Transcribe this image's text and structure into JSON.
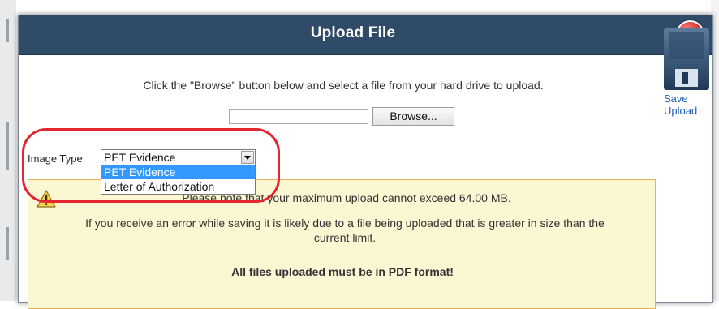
{
  "dialog": {
    "title": "Upload File"
  },
  "upload": {
    "instruction": "Click the \"Browse\" button below and select a file from your hard drive to upload.",
    "file_value": "",
    "browse_label": "Browse..."
  },
  "image_type": {
    "label": "Image Type:",
    "selected": "PET Evidence",
    "options": [
      "PET Evidence",
      "Letter of Authorization"
    ]
  },
  "notice": {
    "line1": "Please note that your maximum upload cannot exceed 64.00 MB.",
    "line2": "If you receive an error while saving it is likely due to a file being uploaded that is greater in size than the current limit.",
    "line3": "All files uploaded must be in PDF format!"
  },
  "sidebar": {
    "save_upload_label": "Save Upload"
  },
  "colors": {
    "titlebar": "#2f4b67",
    "notice_bg": "#fbf7d3",
    "notice_border": "#e5b15a",
    "highlight": "#e3262f",
    "link": "#1a5fb4",
    "selection": "#3399ff"
  },
  "icons": [
    "close-icon",
    "warning-icon",
    "floppy-disk-icon",
    "dropdown-arrow-icon"
  ]
}
